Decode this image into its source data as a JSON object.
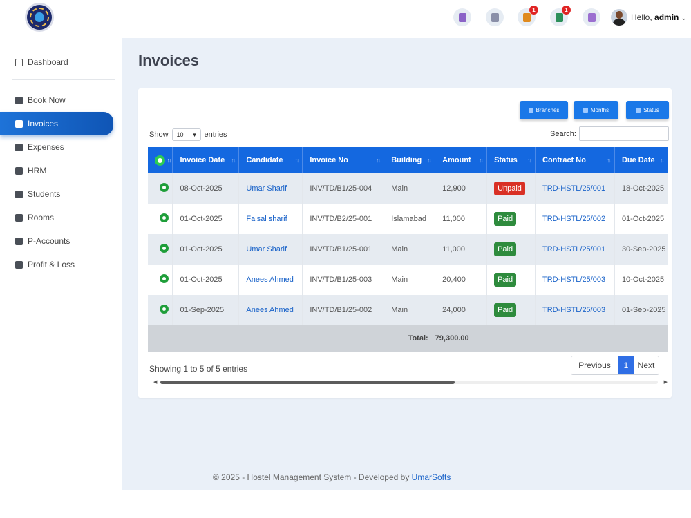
{
  "header": {
    "greeting": "Hello,",
    "username": "admin",
    "notifications": [
      {
        "icon": "purple-doc-icon",
        "color": "#8b63c7",
        "badge": ""
      },
      {
        "icon": "gray-doc-icon",
        "color": "#8a8fa8",
        "badge": ""
      },
      {
        "icon": "book-icon",
        "color": "#e08a1e",
        "badge": "1"
      },
      {
        "icon": "chart-icon",
        "color": "#2c8f5a",
        "badge": "1"
      },
      {
        "icon": "purple-list-icon",
        "color": "#9b6fd0",
        "badge": ""
      }
    ]
  },
  "sidebar": {
    "items": [
      {
        "label": "Dashboard",
        "icon": "home-icon"
      },
      {
        "label": "Book Now",
        "icon": "calendar-icon"
      },
      {
        "label": "Invoices",
        "icon": "invoice-icon",
        "active": true
      },
      {
        "label": "Expenses",
        "icon": "expenses-icon"
      },
      {
        "label": "HRM",
        "icon": "hrm-icon"
      },
      {
        "label": "Students",
        "icon": "students-icon"
      },
      {
        "label": "Rooms",
        "icon": "bed-icon"
      },
      {
        "label": "P-Accounts",
        "icon": "accounts-icon"
      },
      {
        "label": "Profit & Loss",
        "icon": "report-icon"
      }
    ]
  },
  "page": {
    "title": "Invoices"
  },
  "filters": {
    "branches": "Branches",
    "months": "Months",
    "status": "Status"
  },
  "table_controls": {
    "show_label": "Show",
    "entries_value": "10",
    "entries_label": "entries",
    "search_label": "Search:",
    "search_value": ""
  },
  "table": {
    "columns": [
      "Invoice Date",
      "Candidate",
      "Invoice No",
      "Building",
      "Amount",
      "Status",
      "Contract No",
      "Due Date"
    ],
    "rows": [
      [
        "08-Oct-2025",
        "Umar Sharif",
        "INV/TD/B1/25-004",
        "Main",
        "12,900",
        "Unpaid",
        "TRD-HSTL/25/001",
        "18-Oct-2025"
      ],
      [
        "01-Oct-2025",
        "Faisal sharif",
        "INV/TD/B2/25-001",
        "Islamabad",
        "11,000",
        "Paid",
        "TRD-HSTL/25/002",
        "01-Oct-2025"
      ],
      [
        "01-Oct-2025",
        "Umar Sharif",
        "INV/TD/B1/25-001",
        "Main",
        "11,000",
        "Paid",
        "TRD-HSTL/25/001",
        "30-Sep-2025"
      ],
      [
        "01-Oct-2025",
        "Anees Ahmed",
        "INV/TD/B1/25-003",
        "Main",
        "20,400",
        "Paid",
        "TRD-HSTL/25/003",
        "10-Oct-2025"
      ],
      [
        "01-Sep-2025",
        "Anees Ahmed",
        "INV/TD/B1/25-002",
        "Main",
        "24,000",
        "Paid",
        "TRD-HSTL/25/003",
        "01-Sep-2025"
      ]
    ],
    "total_label": "Total:",
    "total_value": "79,300.00"
  },
  "pagination": {
    "info": "Showing 1 to 5 of 5 entries",
    "previous": "Previous",
    "current": "1",
    "next": "Next"
  },
  "footer": {
    "text": "© 2025 - Hostel Management System - Developed by",
    "brand": "UmarSofts"
  },
  "colors": {
    "accent": "#1468e0",
    "paid": "#2e8b3d",
    "unpaid": "#d93025"
  }
}
